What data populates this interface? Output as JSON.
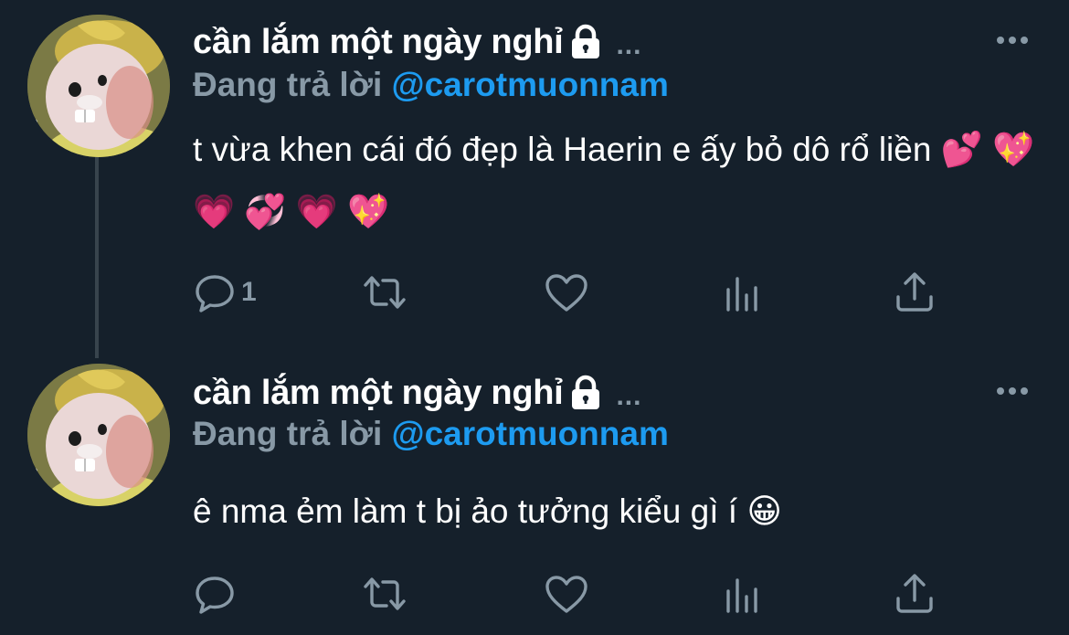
{
  "colors": {
    "background": "#15202b",
    "text": "#ffffff",
    "muted": "#8899a6",
    "mention": "#1d9bf0",
    "thread_line": "#38444d"
  },
  "tweets": [
    {
      "display_name": "cần lắm một ngày nghỉ",
      "locked_icon": "lock-icon",
      "more_label": "...",
      "reply_prefix": "Đang trả lời",
      "reply_to": "@carotmuonnam",
      "text": "t vừa khen cái đó đẹp là Haerin e ấy bỏ dô rổ liền 💕 💖 💗 💞 💗 💖",
      "reply_count": "1",
      "icons": [
        "reply-icon",
        "retweet-icon",
        "like-icon",
        "analytics-icon",
        "share-icon"
      ]
    },
    {
      "display_name": "cần lắm một ngày nghỉ",
      "locked_icon": "lock-icon",
      "more_label": "...",
      "reply_prefix": "Đang trả lời",
      "reply_to": "@carotmuonnam",
      "text": "ê nma ẻm làm t bị ảo tưởng kiểu gì í 😀",
      "reply_count": "",
      "icons": [
        "reply-icon",
        "retweet-icon",
        "like-icon",
        "analytics-icon",
        "share-icon"
      ]
    }
  ]
}
